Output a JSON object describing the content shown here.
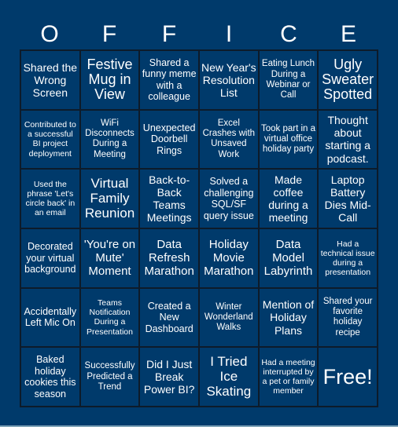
{
  "header": {
    "letters": [
      "O",
      "F",
      "F",
      "I",
      "C",
      "E"
    ]
  },
  "board": {
    "rows": [
      [
        "Shared the Wrong Screen",
        "Festive Mug in View",
        "Shared a funny meme with a colleague",
        "New Year's Resolution List",
        "Eating Lunch During a Webinar or Call",
        "Ugly Sweater Spotted"
      ],
      [
        "Contributed to a successful BI project deployment",
        "WiFi Disconnects During a Meeting",
        "Unexpected Doorbell Rings",
        "Excel Crashes with Unsaved Work",
        "Took part in a virtual office holiday party",
        "Thought about starting a podcast."
      ],
      [
        "Used the phrase 'Let's circle back' in an email",
        "Virtual Family Reunion",
        "Back-to-Back Teams Meetings",
        "Solved a challenging SQL/SF query issue",
        "Made coffee during a meeting",
        "Laptop Battery Dies Mid-Call"
      ],
      [
        "Decorated your virtual background",
        "'You're on Mute' Moment",
        "Data Refresh Marathon",
        "Holiday Movie Marathon",
        "Data Model Labyrinth",
        "Had a technical issue during a presentation"
      ],
      [
        "Accidentally Left Mic On",
        "Teams Notification During a Presentation",
        "Created a New Dashboard",
        "Winter Wonderland Walks",
        "Mention of Holiday Plans",
        "Shared your favorite holiday recipe"
      ],
      [
        "Baked holiday cookies this season",
        "Successfully Predicted a Trend",
        "Did I Just Break Power BI?",
        "I Tried Ice Skating",
        "Had a meeting interrupted by a pet or family member",
        "Free!"
      ]
    ]
  },
  "colors": {
    "background": "#003a6b",
    "grid_line": "#0d1b2a",
    "text": "#ffffff"
  }
}
